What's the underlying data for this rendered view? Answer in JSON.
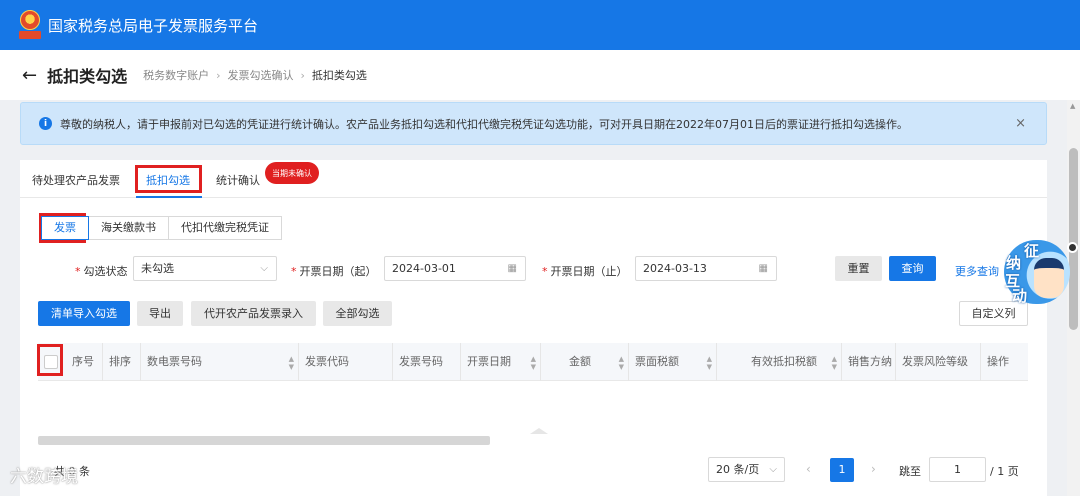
{
  "header": {
    "title": "国家税务总局电子发票服务平台",
    "emblem_text": "Taxes"
  },
  "page": {
    "title": "抵扣类勾选",
    "breadcrumb": [
      "税务数字账户",
      "发票勾选确认",
      "抵扣类勾选"
    ],
    "back_icon": "←"
  },
  "notice": {
    "icon": "i",
    "text": "尊敬的纳税人，请于申报前对已勾选的凭证进行统计确认。农产品业务抵扣勾选和代扣代缴完税凭证勾选功能，可对开具日期在2022年07月01日后的票证进行抵扣勾选操作。",
    "close": "×"
  },
  "tabs": {
    "items": [
      "待处理农产品发票",
      "抵扣勾选",
      "统计确认"
    ],
    "active": "抵扣勾选",
    "badge": "当期未确认"
  },
  "doc_types": {
    "items": [
      "发票",
      "海关缴款书",
      "代扣代缴完税凭证"
    ],
    "active": "发票"
  },
  "filters": {
    "status_label": "勾选状态",
    "status_value": "未勾选",
    "start_label": "开票日期（起）",
    "start_value": "2024-03-01",
    "end_label": "开票日期（止）",
    "end_value": "2024-03-13",
    "reset": "重置",
    "query": "查询",
    "more": "更多查询"
  },
  "actions": {
    "import": "清单导入勾选",
    "export": "导出",
    "agri_entry": "代开农产品发票录入",
    "select_all": "全部勾选",
    "custom_cols": "自定义列"
  },
  "table": {
    "columns": [
      "序号",
      "排序",
      "数电票号码",
      "发票代码",
      "发票号码",
      "开票日期",
      "金额",
      "票面税额",
      "有效抵扣税额",
      "销售方纳",
      "发票风险等级",
      "操作"
    ]
  },
  "pagination": {
    "total": "共 0 条",
    "page_size": "20 条/页",
    "current": "1",
    "jump_label": "跳至",
    "jump_value": "1",
    "pages": "/ 1 页"
  },
  "mascot": {
    "chars": [
      "征",
      "纳",
      "互",
      "动"
    ]
  },
  "watermark": "六数跨境",
  "colors": {
    "primary": "#1677e6",
    "highlight": "#e02020",
    "notice_bg": "#cfe6fb"
  }
}
